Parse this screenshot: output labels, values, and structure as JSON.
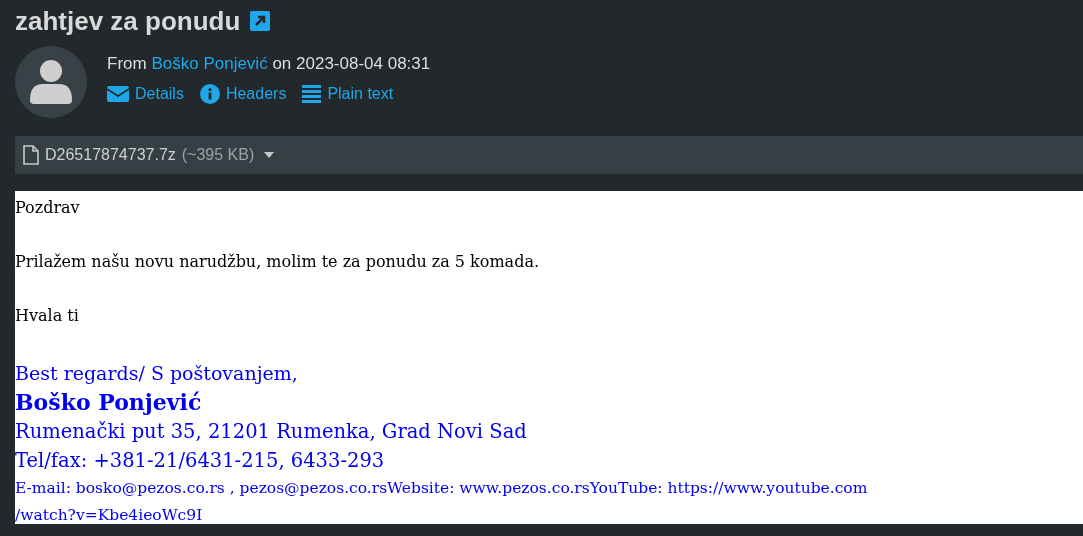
{
  "title": "zahtjev za ponudu",
  "from": {
    "prefix": "From",
    "sender": "Boško Ponjević",
    "middle": "on",
    "date": "2023-08-04 08:31"
  },
  "actions": [
    {
      "kind": "details",
      "label": "Details"
    },
    {
      "kind": "headers",
      "label": "Headers"
    },
    {
      "kind": "plain",
      "label": "Plain text"
    }
  ],
  "attachment": {
    "name": "D26517874737.7z",
    "size": "(~395 KB)"
  },
  "body": [
    "Pozdrav",
    "Prilažem našu novu narudžbu, molim te za ponudu za 5 komada.",
    "Hvala ti"
  ],
  "signature": [
    {
      "kind": "regards",
      "text": "Best regards/ S poštovanjem,"
    },
    {
      "kind": "name",
      "text": "Boško Ponjević"
    },
    {
      "kind": "line",
      "text": "Rumenački put 35, 21201 Rumenka, Grad Novi Sad"
    },
    {
      "kind": "line",
      "text": "Tel/fax: +381-21/6431-215, 6433-293"
    },
    {
      "kind": "small",
      "text": "E-mail: bosko@pezos.co.rs , pezos@pezos.co.rsWebsite: www.pezos.co.rsYouTube: https://www.youtube.com"
    },
    {
      "kind": "small",
      "text": "/watch?v=Kbe4ieoWc9I"
    }
  ]
}
